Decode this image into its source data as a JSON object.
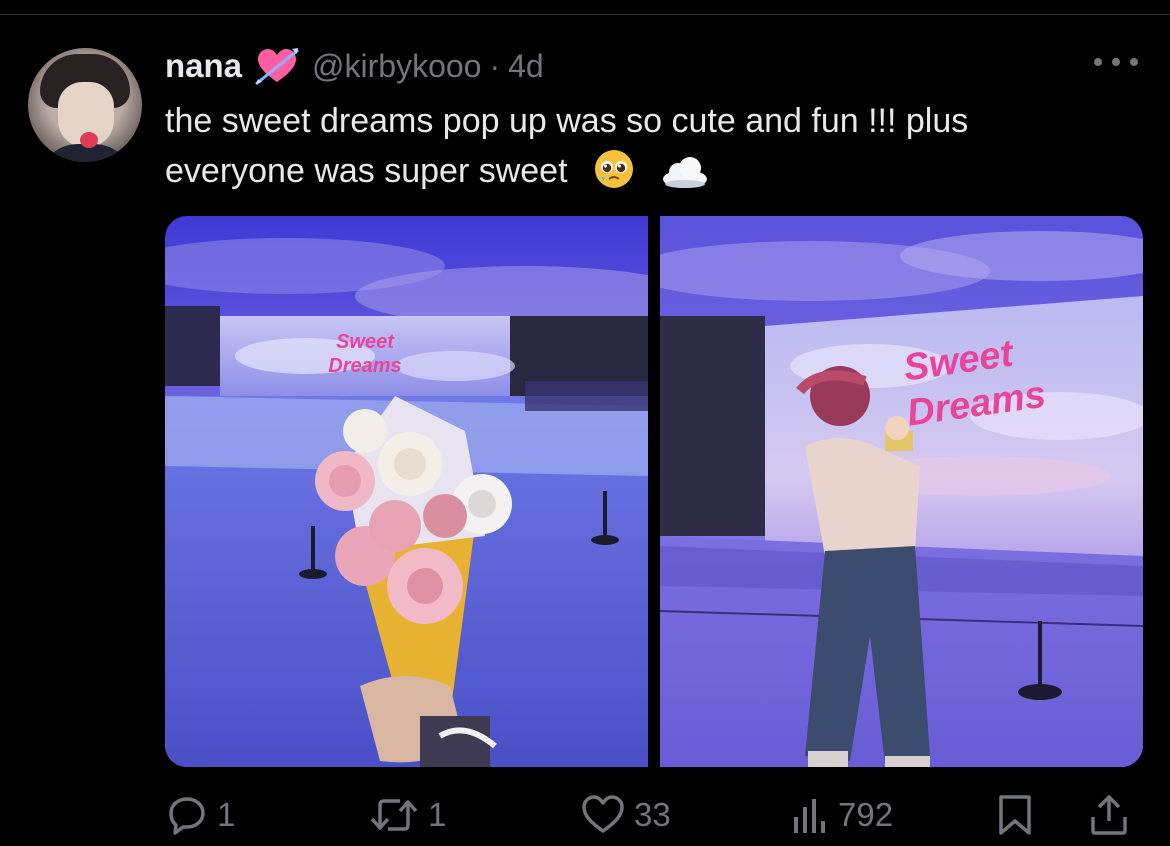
{
  "tweet": {
    "display_name": "nana",
    "handle": "@kirbykooo",
    "separator": "·",
    "time": "4d",
    "text_line1": "the sweet dreams pop up was so cute and fun !!! plus",
    "text_line2": "everyone was super sweet",
    "photos": [
      {
        "sign_line1": "Sweet",
        "sign_line2": "Dreams"
      },
      {
        "sign_line1": "Sweet",
        "sign_line2": "Dreams"
      }
    ]
  },
  "actions": {
    "replies": "1",
    "reposts": "1",
    "likes": "33",
    "views": "792"
  },
  "icons": {
    "header": "heart-with-arrow-icon",
    "emojis": [
      "pleading-face-icon",
      "cloud-icon"
    ]
  },
  "colors": {
    "background": "#000000",
    "primary_text": "#e7e9ea",
    "secondary_text": "#71767b",
    "sign_pink": "#e8459a"
  }
}
